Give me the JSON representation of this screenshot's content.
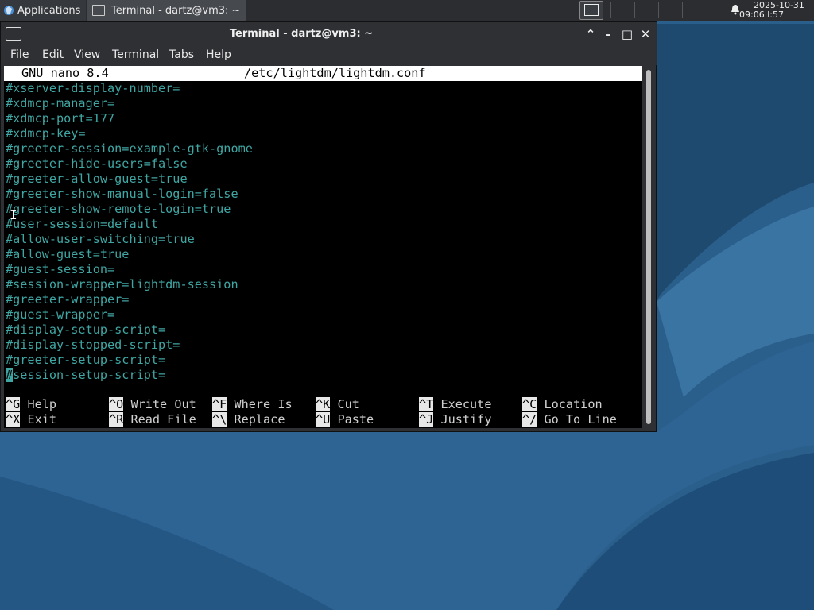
{
  "panel": {
    "applications_label": "Applications",
    "task_label": "Terminal - dartz@vm3: ~",
    "clock_date": "2025-10-31",
    "clock_time": "09:06  l:57"
  },
  "window": {
    "title": "Terminal - dartz@vm3: ~",
    "menu": [
      "File",
      "Edit",
      "View",
      "Terminal",
      "Tabs",
      "Help"
    ]
  },
  "nano": {
    "version": "GNU nano 8.4",
    "filename": "/etc/lightdm/lightdm.conf",
    "lines": [
      "#xserver-display-number=",
      "#xdmcp-manager=",
      "#xdmcp-port=177",
      "#xdmcp-key=",
      "#greeter-session=example-gtk-gnome",
      "#greeter-hide-users=false",
      "#greeter-allow-guest=true",
      "#greeter-show-manual-login=false",
      "#greeter-show-remote-login=true",
      "#user-session=default",
      "#allow-user-switching=true",
      "#allow-guest=true",
      "#guest-session=",
      "#session-wrapper=lightdm-session",
      "#greeter-wrapper=",
      "#guest-wrapper=",
      "#display-setup-script=",
      "#display-stopped-script=",
      "#greeter-setup-script=",
      "session-setup-script="
    ],
    "cursor_char": "#",
    "shortcuts": [
      {
        "key": "^G",
        "label": "Help"
      },
      {
        "key": "^O",
        "label": "Write Out"
      },
      {
        "key": "^F",
        "label": "Where Is"
      },
      {
        "key": "^K",
        "label": "Cut"
      },
      {
        "key": "^T",
        "label": "Execute"
      },
      {
        "key": "^C",
        "label": "Location"
      },
      {
        "key": "^X",
        "label": "Exit"
      },
      {
        "key": "^R",
        "label": "Read File"
      },
      {
        "key": "^\\",
        "label": "Replace"
      },
      {
        "key": "^U",
        "label": "Paste"
      },
      {
        "key": "^J",
        "label": "Justify"
      },
      {
        "key": "^/",
        "label": "Go To Line"
      }
    ]
  },
  "colors": {
    "comment_text": "#3fa6a3",
    "desktop_bg": "#2a5d88"
  }
}
